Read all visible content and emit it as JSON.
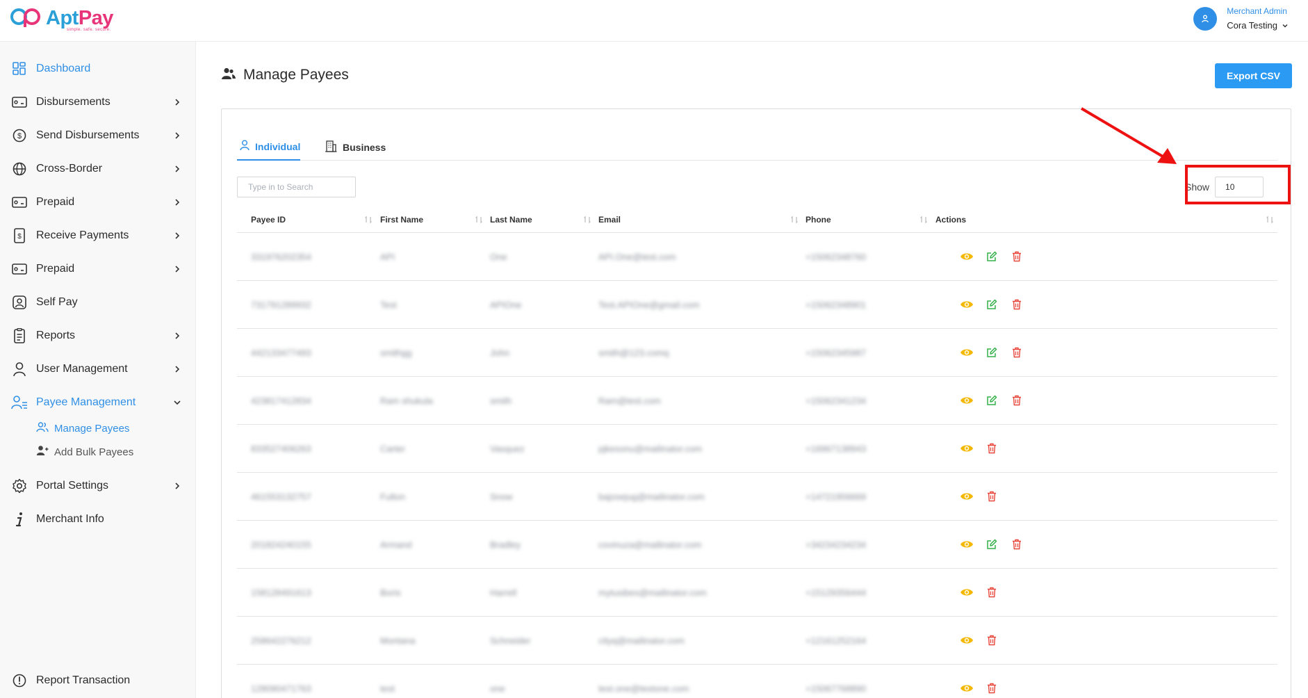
{
  "header": {
    "logo_name_a": "Apt",
    "logo_name_b": "Pay",
    "logo_tagline": "simple. safe. secure.",
    "user_role": "Merchant Admin",
    "user_name": "Cora Testing"
  },
  "sidebar": {
    "items": [
      {
        "label": "Dashboard",
        "icon": "dashboard-grid-icon",
        "active": true
      },
      {
        "label": "Disbursements",
        "icon": "cash-icon",
        "has_children": true
      },
      {
        "label": "Send Disbursements",
        "icon": "dollar-circle-icon",
        "has_children": true
      },
      {
        "label": "Cross-Border",
        "icon": "globe-icon",
        "has_children": true
      },
      {
        "label": "Prepaid",
        "icon": "cash-icon",
        "has_children": true
      },
      {
        "label": "Receive Payments",
        "icon": "invoice-icon",
        "has_children": true
      },
      {
        "label": "Prepaid",
        "icon": "cash-icon",
        "has_children": true
      },
      {
        "label": "Self Pay",
        "icon": "user-square-icon"
      },
      {
        "label": "Reports",
        "icon": "report-icon",
        "has_children": true
      },
      {
        "label": "User Management",
        "icon": "user-icon",
        "has_children": true
      },
      {
        "label": "Payee Management",
        "icon": "users-list-icon",
        "expanded": true,
        "active": true
      },
      {
        "label": "Portal Settings",
        "icon": "gear-icon",
        "has_children": true
      },
      {
        "label": "Merchant Info",
        "icon": "info-icon"
      }
    ],
    "sub_items": [
      {
        "label": "Manage Payees",
        "icon": "users-icon",
        "active": true
      },
      {
        "label": "Add Bulk Payees",
        "icon": "user-plus-icon"
      }
    ],
    "footer_item": {
      "label": "Report Transaction",
      "icon": "alert-circle-icon"
    }
  },
  "main": {
    "title": "Manage Payees",
    "export_label": "Export CSV",
    "tabs": [
      {
        "label": "Individual",
        "active": true
      },
      {
        "label": "Business",
        "active": false
      }
    ],
    "search_placeholder": "Type in to Search",
    "show_label": "Show",
    "show_value": "10",
    "columns": [
      "Payee ID",
      "First Name",
      "Last Name",
      "Email",
      "Phone",
      "Actions"
    ],
    "rows": [
      {
        "id": "331976202354",
        "first": "API",
        "last": "One",
        "email": "API.One@test.com",
        "phone": "+15062348760",
        "edit": true
      },
      {
        "id": "731791289932",
        "first": "Test",
        "last": "APIOne",
        "email": "Test.APIOne@gmail.com",
        "phone": "+15062348901",
        "edit": true
      },
      {
        "id": "442133477493",
        "first": "smithgg",
        "last": "John",
        "email": "smith@123.comq",
        "phone": "+15062345987",
        "edit": true
      },
      {
        "id": "423817412834",
        "first": "Ram shukula",
        "last": "smith",
        "email": "Ram@test.com",
        "phone": "+15062341234",
        "edit": true
      },
      {
        "id": "833527406263",
        "first": "Carter",
        "last": "Vasquez",
        "email": "pjkesonu@mailinator.com",
        "phone": "+16967138943",
        "edit": false
      },
      {
        "id": "461553132757",
        "first": "Fulton",
        "last": "Snow",
        "email": "bajosejug@mailinator.com",
        "phone": "+14721956669",
        "edit": false
      },
      {
        "id": "201824240155",
        "first": "Armand",
        "last": "Bradley",
        "email": "covinuza@mailinator.com",
        "phone": "+34234234234",
        "edit": true
      },
      {
        "id": "158128491613",
        "first": "Boris",
        "last": "Harrell",
        "email": "mytusibes@mailinator.com",
        "phone": "+15129356444",
        "edit": false
      },
      {
        "id": "258642276212",
        "first": "Montana",
        "last": "Schneider",
        "email": "cityq@mailinator.com",
        "phone": "+12161252164",
        "edit": false
      },
      {
        "id": "128090471763",
        "first": "test",
        "last": "one",
        "email": "test.one@testone.com",
        "phone": "+15067768890",
        "edit": false
      }
    ]
  },
  "colors": {
    "accent": "#2f8fe6",
    "export_button": "#2b9af3",
    "view_icon": "#f5b800",
    "edit_icon": "#34b04a",
    "delete_icon": "#e8463a",
    "annotation": "#ee1111"
  }
}
